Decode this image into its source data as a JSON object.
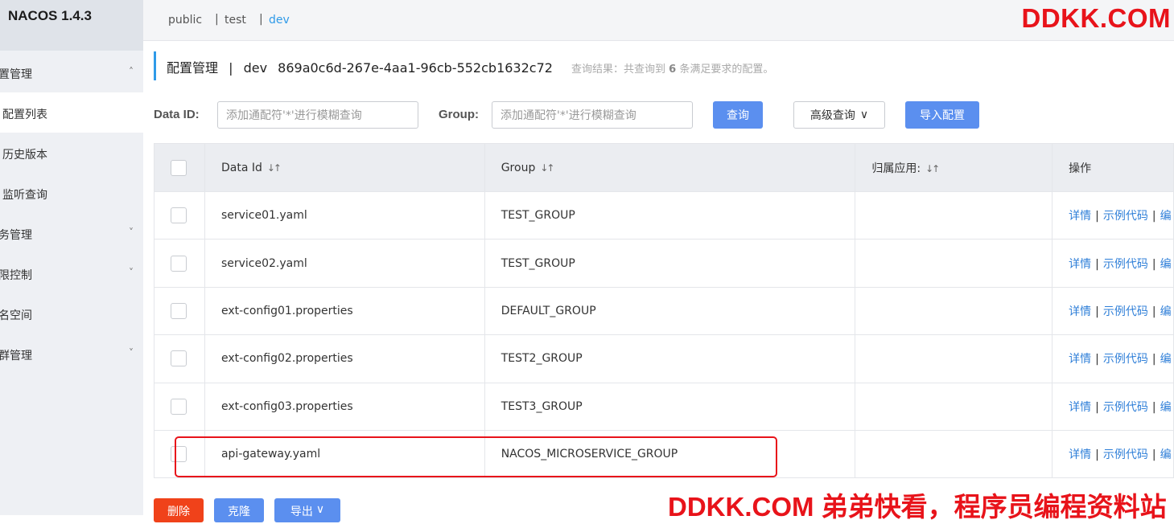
{
  "app": {
    "title": "NACOS 1.4.3"
  },
  "sidebar": {
    "items": [
      {
        "label": "置管理",
        "chevron": "˄"
      },
      {
        "label": "配置列表",
        "chevron": ""
      },
      {
        "label": "历史版本",
        "chevron": ""
      },
      {
        "label": "监听查询",
        "chevron": ""
      },
      {
        "label": "务管理",
        "chevron": "˅"
      },
      {
        "label": "限控制",
        "chevron": "˅"
      },
      {
        "label": "名空间",
        "chevron": ""
      },
      {
        "label": "群管理",
        "chevron": "˅"
      }
    ]
  },
  "namespaces": {
    "public": "public",
    "test": "test",
    "dev": "dev",
    "sep": "|"
  },
  "watermark": {
    "top": "DDKK.COM",
    "bottom": "DDKK.COM 弟弟快看，程序员编程资料站"
  },
  "page": {
    "title": "配置管理",
    "sep": "|",
    "namespace": "dev",
    "namespace_id": "869a0c6d-267e-4aa1-96cb-552cb1632c72",
    "result_prefix": "查询结果：共查询到 ",
    "result_count": "6",
    "result_suffix": " 条满足要求的配置。"
  },
  "filters": {
    "data_id_label": "Data ID:",
    "data_id_placeholder": "添加通配符'*'进行模糊查询",
    "group_label": "Group:",
    "group_placeholder": "添加通配符'*'进行模糊查询",
    "search_button": "查询",
    "advanced_button": "高级查询",
    "advanced_chevron": "∨",
    "import_button": "导入配置"
  },
  "table": {
    "headers": {
      "data_id": "Data Id",
      "group": "Group",
      "app": "归属应用:",
      "ops": "操作",
      "sort_icon": "↓↑"
    },
    "ops": {
      "detail": "详情",
      "sample": "示例代码",
      "sep": "|",
      "more": "编"
    },
    "rows": [
      {
        "data_id": "service01.yaml",
        "group": "TEST_GROUP",
        "app": ""
      },
      {
        "data_id": "service02.yaml",
        "group": "TEST_GROUP",
        "app": ""
      },
      {
        "data_id": "ext-config01.properties",
        "group": "DEFAULT_GROUP",
        "app": ""
      },
      {
        "data_id": "ext-config02.properties",
        "group": "TEST2_GROUP",
        "app": ""
      },
      {
        "data_id": "ext-config03.properties",
        "group": "TEST3_GROUP",
        "app": ""
      },
      {
        "data_id": "api-gateway.yaml",
        "group": "NACOS_MICROSERVICE_GROUP",
        "app": ""
      }
    ]
  },
  "bottom": {
    "delete_button": "删除",
    "clone_button": "克隆",
    "export_button": "导出",
    "export_chevron": "∨"
  },
  "colors": {
    "accent": "#2f9ae8",
    "primary_button": "#5b8fef",
    "danger": "#f0421a",
    "highlight": "#e8131a"
  }
}
